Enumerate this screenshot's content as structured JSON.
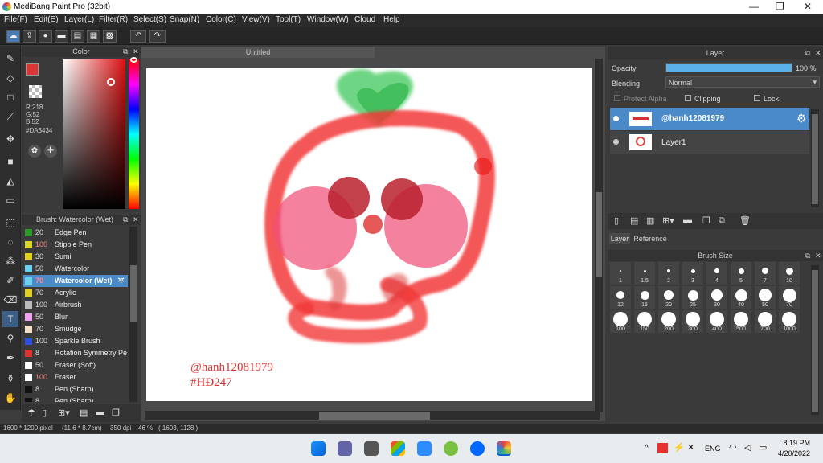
{
  "window": {
    "title": "MediBang Paint Pro (32bit)",
    "min": "—",
    "max": "❐",
    "close": "✕"
  },
  "menu": [
    "File(F)",
    "Edit(E)",
    "Layer(L)",
    "Filter(R)",
    "Select(S)",
    "Snap(N)",
    "Color(C)",
    "View(V)",
    "Tool(T)",
    "Window(W)",
    "Cloud",
    "Help"
  ],
  "toolbar_icons": [
    "cloud-icon",
    "upload-icon",
    "comment-icon",
    "comment-alt-icon",
    "page-icon",
    "pages-icon",
    "grid-icon",
    "undo-icon",
    "redo-icon"
  ],
  "color_panel": {
    "title": "Color",
    "r": "R:218",
    "g": "G:52",
    "b": "B:52",
    "hex": "#DA3434",
    "fg_color": "#da3434"
  },
  "brush_panel": {
    "title": "Brush: Watercolor (Wet)",
    "items": [
      {
        "num": "20",
        "name": "Edge Pen",
        "color": "#2a9a2a"
      },
      {
        "num": "100",
        "name": "Stipple Pen",
        "color": "#d8d820",
        "red": true
      },
      {
        "num": "30",
        "name": "Sumi",
        "color": "#e0d020"
      },
      {
        "num": "50",
        "name": "Watercolor",
        "color": "#6ad0f0"
      },
      {
        "num": "70",
        "name": "Watercolor (Wet)",
        "color": "#6ad0f0",
        "selected": true,
        "red": true
      },
      {
        "num": "70",
        "name": "Acrylic",
        "color": "#e0d020"
      },
      {
        "num": "100",
        "name": "Airbrush",
        "color": "#bbbbbb"
      },
      {
        "num": "50",
        "name": "Blur",
        "color": "#f0a0f0"
      },
      {
        "num": "70",
        "name": "Smudge",
        "color": "#f4e0c8"
      },
      {
        "num": "100",
        "name": "Sparkle Brush",
        "color": "#3050e0"
      },
      {
        "num": "8",
        "name": "Rotation Symmetry Pe",
        "color": "#e03030"
      },
      {
        "num": "50",
        "name": "Eraser (Soft)",
        "color": "#ffffff"
      },
      {
        "num": "100",
        "name": "Eraser",
        "color": "#ffffff",
        "red": true
      },
      {
        "num": "8",
        "name": "Pen (Sharp)",
        "color": "#111111"
      },
      {
        "num": "8",
        "name": "Pen (Sharp)",
        "color": "#111111"
      }
    ]
  },
  "document": {
    "tab": "Untitled",
    "signature_1": "@hanh12081979",
    "signature_2": "#HĐ247"
  },
  "layer_panel": {
    "title": "Layer",
    "opacity_label": "Opacity",
    "opacity_value": "100 %",
    "opacity": 1.0,
    "blending_label": "Blending",
    "blending_value": "Normal",
    "protect_alpha": "Protect Alpha",
    "clipping": "Clipping",
    "lock": "Lock",
    "layers": [
      {
        "name": "@hanh12081979",
        "selected": true
      },
      {
        "name": "Layer1",
        "selected": false
      }
    ],
    "tab_layer": "Layer",
    "tab_reference": "Reference"
  },
  "brush_size": {
    "title": "Brush Size",
    "sizes": [
      "1",
      "1.5",
      "2",
      "3",
      "4",
      "5",
      "7",
      "10",
      "12",
      "15",
      "20",
      "25",
      "30",
      "40",
      "50",
      "70",
      "100",
      "150",
      "200",
      "300",
      "400",
      "500",
      "700",
      "1000"
    ]
  },
  "status": {
    "size": "1600 * 1200 pixel",
    "cm": "(11.6 * 8.7cm)",
    "dpi": "350 dpi",
    "zoom": "46 %",
    "coords": "( 1603, 1128 )"
  },
  "taskbar": {
    "lang": "ENG",
    "time": "8:19 PM",
    "date": "4/20/2022"
  }
}
